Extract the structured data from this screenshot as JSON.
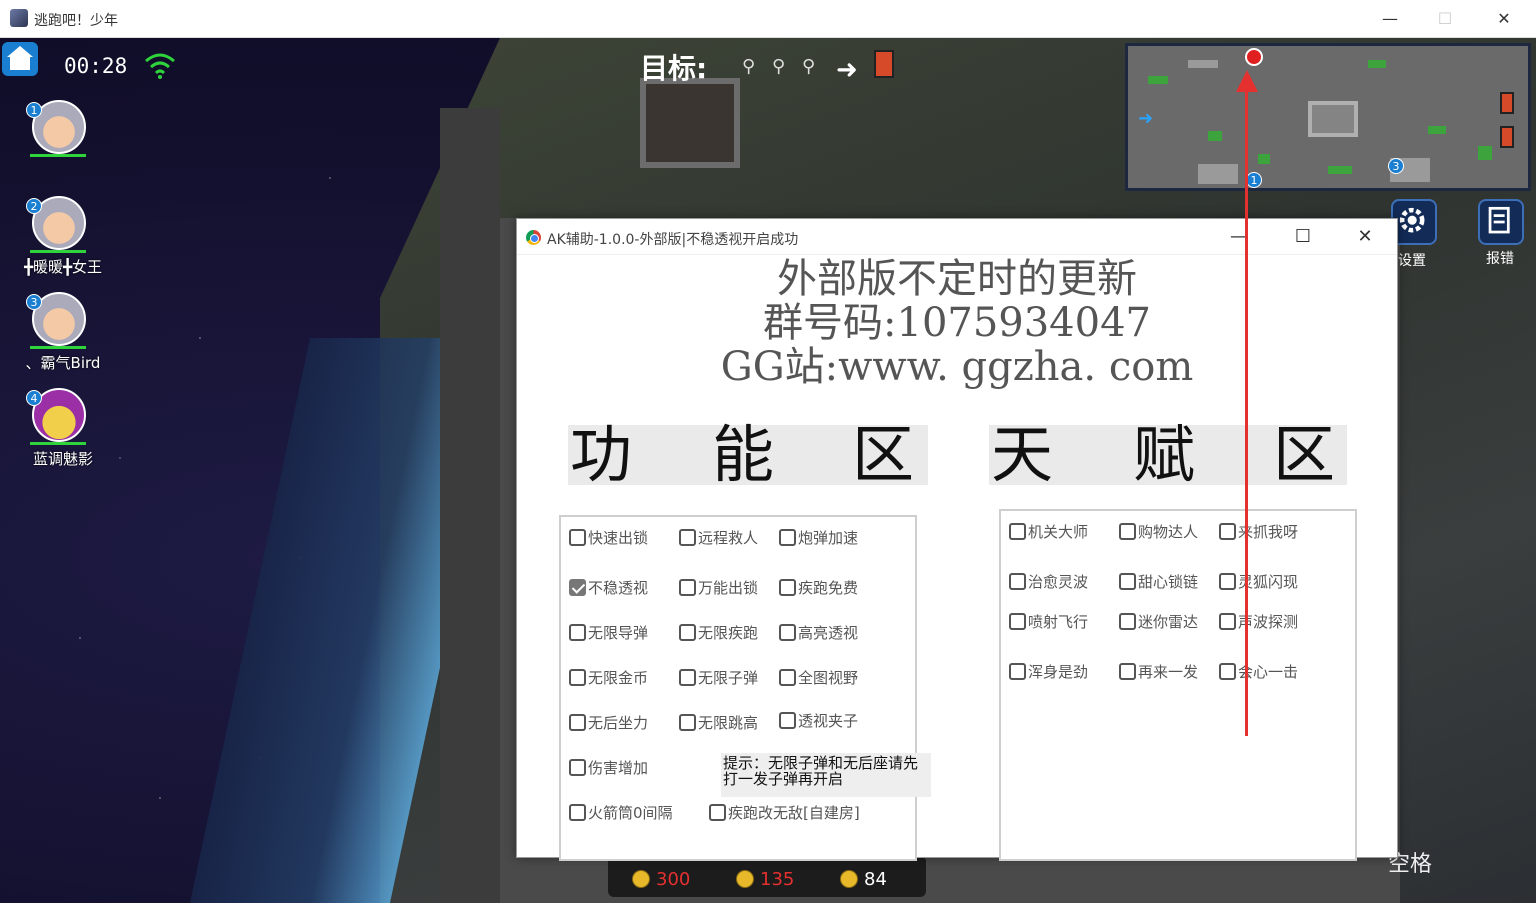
{
  "window": {
    "title": "逃跑吧！少年",
    "min_glyph": "—",
    "max_glyph": "☐",
    "close_glyph": "✕"
  },
  "hud": {
    "timer": "00:28",
    "target_label": "目标:",
    "arrow_glyph": "➜",
    "key_glyph": "⚲",
    "players": [
      {
        "index": "1",
        "name": ""
      },
      {
        "index": "2",
        "name": "╋暖暖╋女王"
      },
      {
        "index": "3",
        "name": "、霸气Bird"
      },
      {
        "index": "4",
        "name": "蓝调魅影"
      }
    ],
    "settings_label": "设置",
    "report_label": "报错",
    "space_label": "空格",
    "stats": {
      "v1": "300",
      "v2": "135",
      "v3": "84"
    },
    "minimap_numbers": [
      "1",
      "3"
    ]
  },
  "dialog": {
    "title": "AK辅助-1.0.0-外部版|不稳透视开启成功",
    "min_glyph": "—",
    "max_glyph": "☐",
    "close_glyph": "✕",
    "announce": [
      "外部版不定时的更新",
      "群号码:1075934047",
      "GG站:www. ggzha. com"
    ],
    "func_head": [
      "功",
      "能",
      "区"
    ],
    "talent_head": [
      "天",
      "赋",
      "区"
    ],
    "functions": [
      {
        "label": "快速出锁",
        "checked": false
      },
      {
        "label": "远程救人",
        "checked": false
      },
      {
        "label": "炮弹加速",
        "checked": false
      },
      {
        "label": "不稳透视",
        "checked": true
      },
      {
        "label": "万能出锁",
        "checked": false
      },
      {
        "label": "疾跑免费",
        "checked": false
      },
      {
        "label": "无限导弹",
        "checked": false
      },
      {
        "label": "无限疾跑",
        "checked": false
      },
      {
        "label": "高亮透视",
        "checked": false
      },
      {
        "label": "无限金币",
        "checked": false
      },
      {
        "label": "无限子弹",
        "checked": false
      },
      {
        "label": "全图视野",
        "checked": false
      },
      {
        "label": "无后坐力",
        "checked": false
      },
      {
        "label": "无限跳高",
        "checked": false
      },
      {
        "label": "透视夹子",
        "checked": false
      },
      {
        "label": "伤害增加",
        "checked": false
      },
      {
        "label": "火箭筒0间隔",
        "checked": false
      },
      {
        "label": "疾跑改无敌[自建房]",
        "checked": false
      }
    ],
    "tip": "提示：无限子弹和无后座请先打一发子弹再开启",
    "talents": [
      {
        "label": "机关大师",
        "checked": false
      },
      {
        "label": "购物达人",
        "checked": false
      },
      {
        "label": "来抓我呀",
        "checked": false
      },
      {
        "label": "治愈灵波",
        "checked": false
      },
      {
        "label": "甜心锁链",
        "checked": false
      },
      {
        "label": "灵狐闪现",
        "checked": false
      },
      {
        "label": "喷射飞行",
        "checked": false
      },
      {
        "label": "迷你雷达",
        "checked": false
      },
      {
        "label": "声波探测",
        "checked": false
      },
      {
        "label": "浑身是劲",
        "checked": false
      },
      {
        "label": "再来一发",
        "checked": false
      },
      {
        "label": "会心一击",
        "checked": false
      }
    ]
  },
  "colors": {
    "accent_red": "#e53030",
    "hud_blue": "#1a7fd0",
    "hp_green": "#2fd33b",
    "stat_red": "#e53030"
  }
}
